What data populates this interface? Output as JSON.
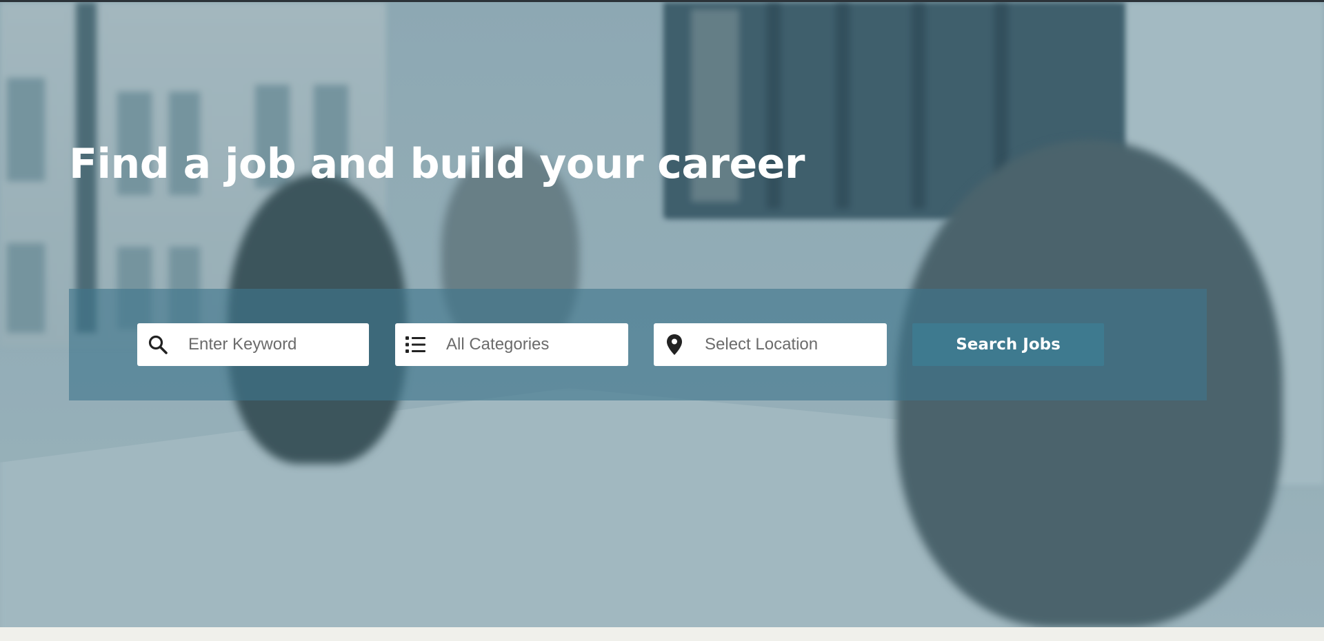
{
  "hero": {
    "headline": "Find a job and build your career"
  },
  "search": {
    "keyword_placeholder": "Enter Keyword",
    "keyword_value": "",
    "category_value": "All Categories",
    "location_placeholder": "Select Location",
    "location_value": "",
    "button_label": "Search Jobs",
    "icons": {
      "keyword": "search-icon",
      "category": "list-icon",
      "location": "map-pin-icon"
    }
  },
  "colors": {
    "headline": "#ffffff",
    "search_band": "#3f768d",
    "search_button": "#3e7a8f",
    "button_text": "#ffffff",
    "icon": "#222222"
  }
}
